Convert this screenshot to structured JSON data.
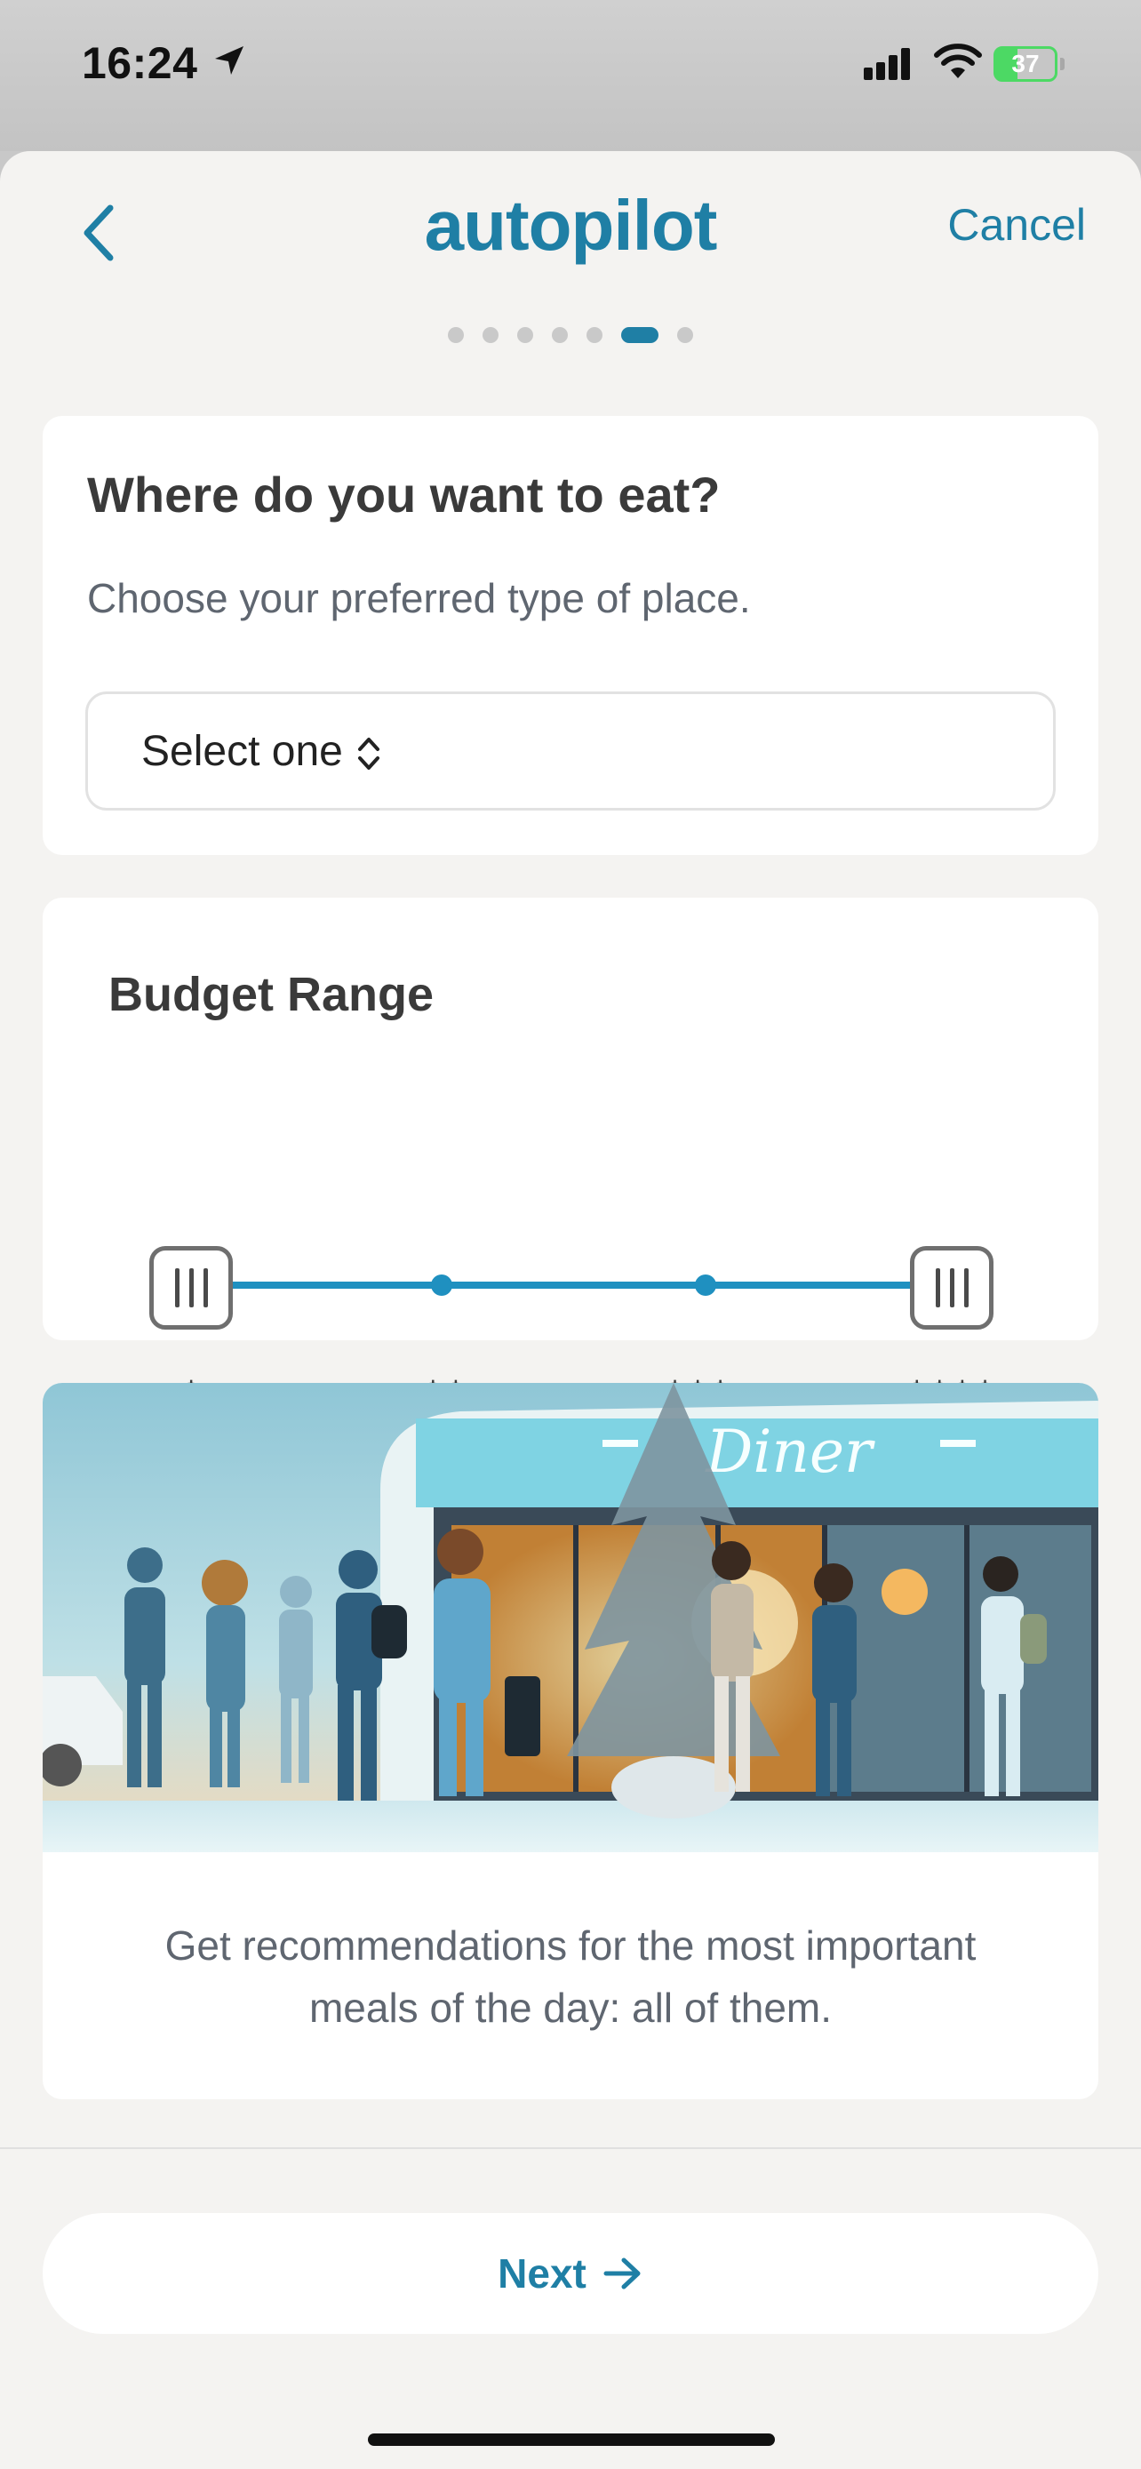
{
  "status_bar": {
    "time": "16:24",
    "battery": "37",
    "battery_level": 0.37
  },
  "nav": {
    "title": "autopilot",
    "cancel_label": "Cancel"
  },
  "progress": {
    "total_steps": 7,
    "current_step": 6
  },
  "where_card": {
    "title": "Where do you want to eat?",
    "subtitle": "Choose your preferred type of place.",
    "select_value": "Select one"
  },
  "budget_card": {
    "title": "Budget Range",
    "stops": [
      "$",
      "$$",
      "$$$",
      "$$$$"
    ],
    "selected_min": "$",
    "selected_max": "$$$$"
  },
  "image_card": {
    "sign_text": "Diner",
    "caption": "Get recommendations for the most important meals of the day: all of them."
  },
  "footer": {
    "next_label": "Next"
  },
  "colors": {
    "accent": "#1f7fa5",
    "slider": "#1f90c0",
    "background": "#f4f3f1"
  }
}
